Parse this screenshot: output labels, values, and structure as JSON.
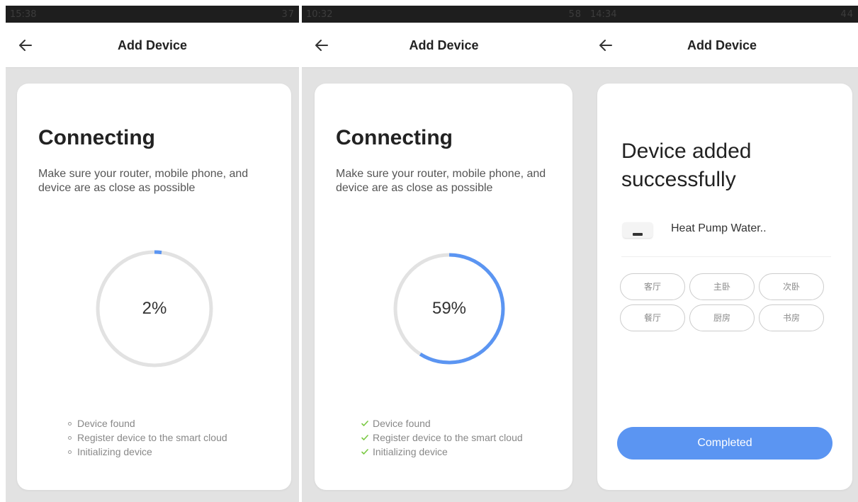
{
  "colors": {
    "accent": "#5b95f2",
    "ring_track": "#e2e2e2",
    "check": "#7ac943"
  },
  "screens": [
    {
      "status": {
        "time": "15:38",
        "right": "37"
      },
      "title": "Add Device",
      "heading": "Connecting",
      "description": "Make sure your router, mobile phone, and device are as close as possible",
      "progress_percent": 2,
      "progress_label": "2%",
      "step_icon": "dot-icon",
      "steps": [
        "Device found",
        "Register device to the smart cloud",
        "Initializing device"
      ]
    },
    {
      "status": {
        "time": "10:32",
        "right": "58"
      },
      "title": "Add Device",
      "heading": "Connecting",
      "description": "Make sure your router, mobile phone, and device are as close as possible",
      "progress_percent": 59,
      "progress_label": "59%",
      "step_icon": "check-icon",
      "steps": [
        "Device found",
        "Register device to the smart cloud",
        "Initializing device"
      ]
    },
    {
      "status": {
        "time": "14:34",
        "right": "44"
      },
      "title": "Add Device",
      "heading": "Device added successfully",
      "device_name": "Heat Pump Water..",
      "rooms": [
        "客厅",
        "主卧",
        "次卧",
        "餐厅",
        "厨房",
        "书房"
      ],
      "button": "Completed"
    }
  ]
}
